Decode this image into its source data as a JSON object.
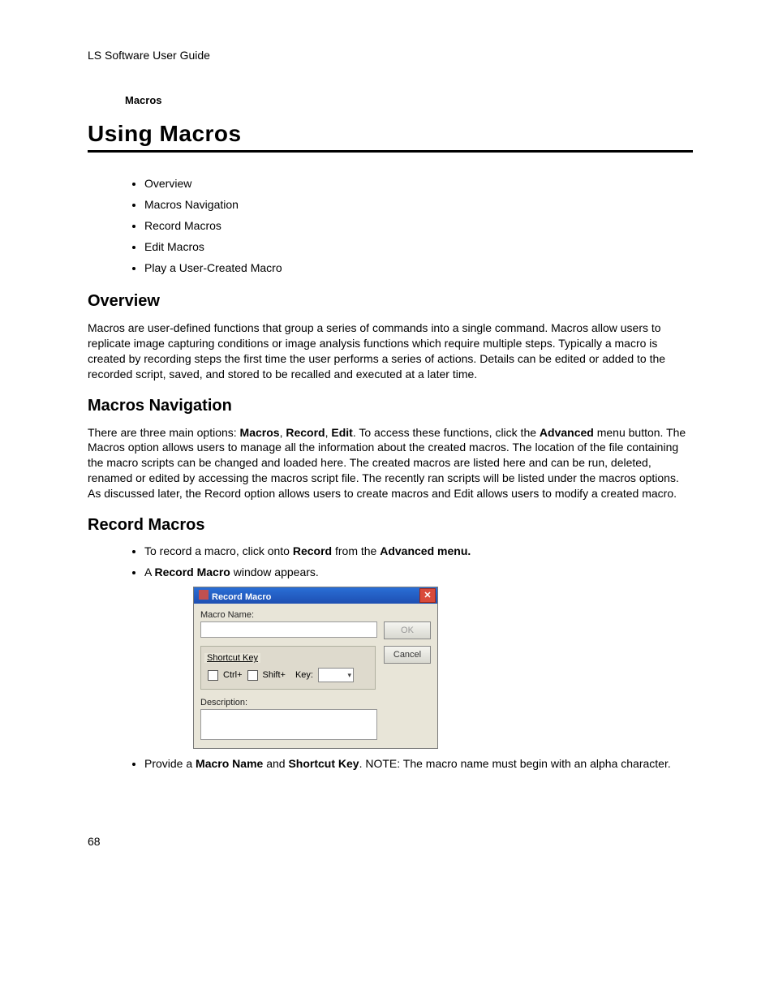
{
  "doc_header": "LS Software User Guide",
  "breadcrumb": "Macros",
  "page_title": "Using Macros",
  "toc": {
    "items": [
      "Overview",
      "Macros Navigation",
      "Record Macros",
      "Edit Macros",
      "Play a User-Created Macro"
    ]
  },
  "sections": {
    "overview": {
      "heading": "Overview",
      "body": "Macros are user-defined functions that group a series of commands into a single command. Macros allow users to replicate image capturing conditions or image analysis functions which require multiple steps. Typically a macro is created by recording steps the first time the user performs a series of actions. Details can be edited or added to the recorded script, saved, and stored to be recalled and executed at a later time."
    },
    "navigation": {
      "heading": "Macros Navigation",
      "body_pre": "There are three main options: ",
      "opt1": "Macros",
      "opt2": "Record",
      "opt3": "Edit",
      "body_mid": ". To access these functions, click the ",
      "advanced": "Advanced",
      "body_post": " menu button. The Macros option allows users to manage all the information about the created macros. The location of the file containing the macro scripts can be changed and loaded here. The created macros are listed here and can be run, deleted, renamed or edited by accessing the macros script file. The recently ran scripts will be listed under the macros options. As discussed later, the Record option allows users to create macros and Edit allows users to modify a created macro."
    },
    "record": {
      "heading": "Record Macros",
      "step1_pre": "To record a macro, click onto ",
      "step1_bold1": "Record",
      "step1_mid": " from the ",
      "step1_bold2": "Advanced menu.",
      "step2_pre": "A ",
      "step2_bold": "Record Macro",
      "step2_post": " window appears.",
      "step3_pre": "Provide a ",
      "step3_bold1": "Macro Name",
      "step3_mid": " and ",
      "step3_bold2": "Shortcut Key",
      "step3_post": ". NOTE: The macro name must begin with an alpha character."
    }
  },
  "dialog": {
    "title": "Record Macro",
    "macro_name_label": "Macro Name:",
    "shortcut_legend": "Shortcut Key",
    "ctrl_label": "Ctrl+",
    "shift_label": "Shift+",
    "key_label": "Key:",
    "description_label": "Description:",
    "ok_label": "OK",
    "cancel_label": "Cancel"
  },
  "page_number": "68"
}
